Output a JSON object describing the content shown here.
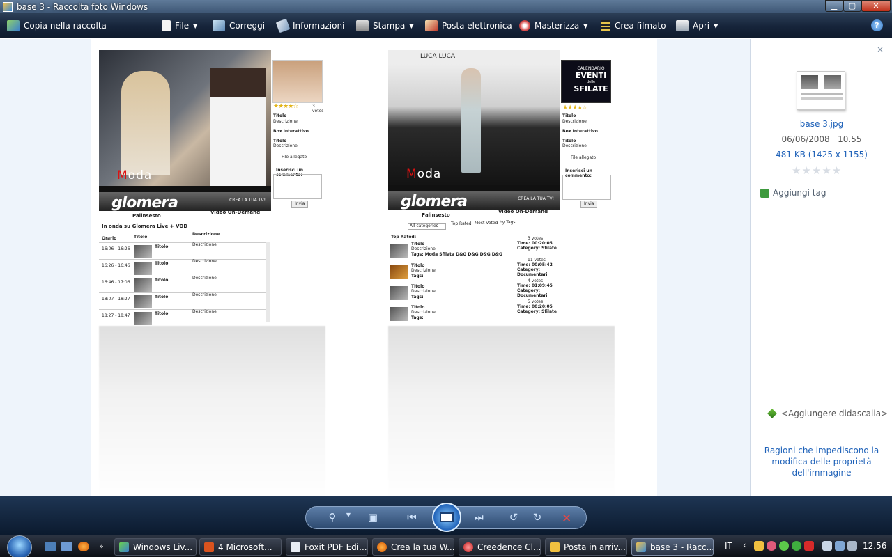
{
  "window": {
    "title": "base 3 - Raccolta foto Windows"
  },
  "toolbar": {
    "copy_to_gallery": "Copia nella raccolta",
    "file": "File",
    "fix": "Correggi",
    "info": "Informazioni",
    "print": "Stampa",
    "email": "Posta elettronica",
    "burn": "Masterizza",
    "make_movie": "Crea filmato",
    "open": "Apri",
    "help": "?"
  },
  "image_left": {
    "moda": "Moda",
    "brand": "glomera",
    "crea": "CREA LA TUA TV!",
    "tab_schedule": "Palinsesto",
    "tab_vod": "Video On-Demand",
    "on_air": "In onda su Glomera Live + VOD",
    "col_time": "Orario",
    "col_title": "Titolo",
    "col_desc": "Descrizione",
    "rows": [
      {
        "time": "16:06 - 16:26",
        "title": "Titolo",
        "desc": "Descrizione"
      },
      {
        "time": "16:26 - 16:46",
        "title": "Titolo",
        "desc": "Descrizione"
      },
      {
        "time": "16:46 - 17:06",
        "title": "Titolo",
        "desc": "Descrizione"
      },
      {
        "time": "18:07 - 18:27",
        "title": "Titolo",
        "desc": "Descrizione"
      },
      {
        "time": "18:27 - 18:47",
        "title": "Titolo",
        "desc": "Descrizione"
      }
    ],
    "side": {
      "votes": "3 votes",
      "title": "Titolo",
      "desc": "Descrizione",
      "box": "Box Interattivo",
      "title2": "Titolo",
      "desc2": "Descrizione",
      "attachment": "File allegato",
      "comment": "Inserisci un commento:",
      "send": "Invia"
    }
  },
  "image_right": {
    "header": "LUCA LUCA",
    "moda": "Moda",
    "brand": "glomera",
    "crea": "CREA LA TUA TV!",
    "tab_schedule": "Palinsesto",
    "tab_vod": "Video On-Demand",
    "categories": "All categories",
    "top_rated_tab": "Top Rated",
    "most_voted": "Most Voted",
    "by_tags": "by Tags",
    "top_rated": "Top Rated:",
    "banner_l1": "CALENDARIO",
    "banner_l2": "EVENTI",
    "banner_l3": "delle",
    "banner_l4": "SFILATE",
    "items": [
      {
        "title": "Titolo",
        "desc": "Descrizione",
        "tags": "Tags: Moda Sfilata D&G D&G D&G D&G",
        "votes": "3 votes",
        "time": "Time: 00:20:05",
        "cat": "Category: Sfilate"
      },
      {
        "title": "Titolo",
        "desc": "Descrizione",
        "tags": "Tags:",
        "votes": "11 votes",
        "time": "Time: 00:05:42",
        "cat": "Category: Documentari"
      },
      {
        "title": "Titolo",
        "desc": "Descrizione",
        "tags": "Tags:",
        "votes": "4 votes",
        "time": "Time: 01:09:45",
        "cat": "Category: Documentari"
      },
      {
        "title": "Titolo",
        "desc": "Descrizione",
        "tags": "Tags:",
        "votes": "5 votes",
        "time": "Time: 00:20:05",
        "cat": "Category: Sfilate"
      }
    ],
    "side": {
      "title": "Titolo",
      "desc": "Descrizione",
      "box": "Box Interattivo",
      "title2": "Titolo",
      "desc2": "Descrizione",
      "attachment": "File allegato",
      "comment": "Inserisci un commento:",
      "send": "Invia"
    }
  },
  "info_panel": {
    "close": "×",
    "filename": "base 3.jpg",
    "date": "06/06/2008",
    "time": "10.55",
    "size": "481 KB (1425 x 1155)",
    "rating_stars": "★★★★★",
    "add_tag": "Aggiungi tag",
    "add_caption": "<Aggiungere didascalia>",
    "reasons": "Ragioni che impediscono la modifica delle proprietà dell'immagine"
  },
  "taskbar": {
    "tasks": [
      {
        "label": "Windows Liv..."
      },
      {
        "label": "4 Microsoft..."
      },
      {
        "label": "Foxit PDF Edi..."
      },
      {
        "label": "Crea la tua W..."
      },
      {
        "label": "Creedence Cl..."
      },
      {
        "label": "Posta in arriv..."
      },
      {
        "label": "base 3 - Racc..."
      }
    ],
    "language": "IT",
    "clock": "12.56"
  }
}
